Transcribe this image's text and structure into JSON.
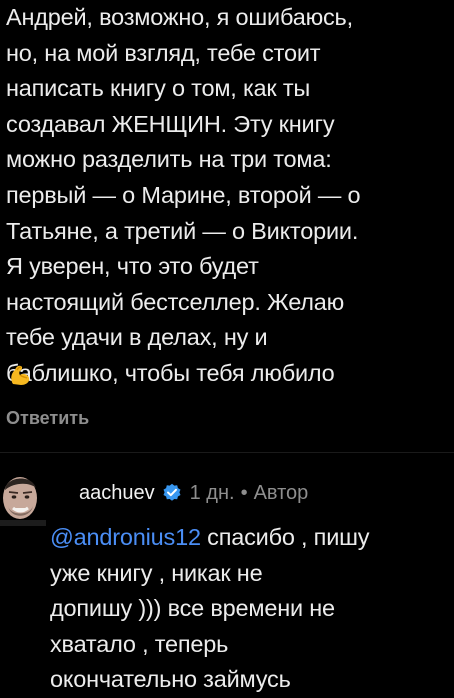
{
  "comment": {
    "lines": [
      "Андрей, возможно, я ошибаюсь,",
      "но, на мой взгляд, тебе стоит",
      "написать книгу о том, как ты",
      "создавал ЖЕНЩИН. Эту книгу",
      "можно разделить на три тома:",
      "первый — о Марине, второй — о",
      "Татьяне, а третий — о Виктории.",
      "Я уверен, что это будет",
      "настоящий бестселлер. Желаю",
      "тебе удачи в делах, ну и",
      "баблишко, чтобы тебя любило"
    ],
    "emoji": "flexed-biceps-emoji",
    "reply_label": "Ответить"
  },
  "reply": {
    "username": "aachuev",
    "verified_icon": "verified-badge-icon",
    "time": "1 дн.",
    "separator": "•",
    "author_label": "Автор",
    "mention": "@andronius12",
    "first_line_rest": " спасибо , пишу",
    "lines": [
      "уже книгу , никак не",
      "допишу ))) все времени не",
      "хватало , теперь",
      "окончательно займусь"
    ]
  },
  "colors": {
    "background": "#000000",
    "text": "#ececec",
    "muted": "#8e8e8e",
    "mention": "#4b8ef5",
    "verified": "#3897f0"
  }
}
